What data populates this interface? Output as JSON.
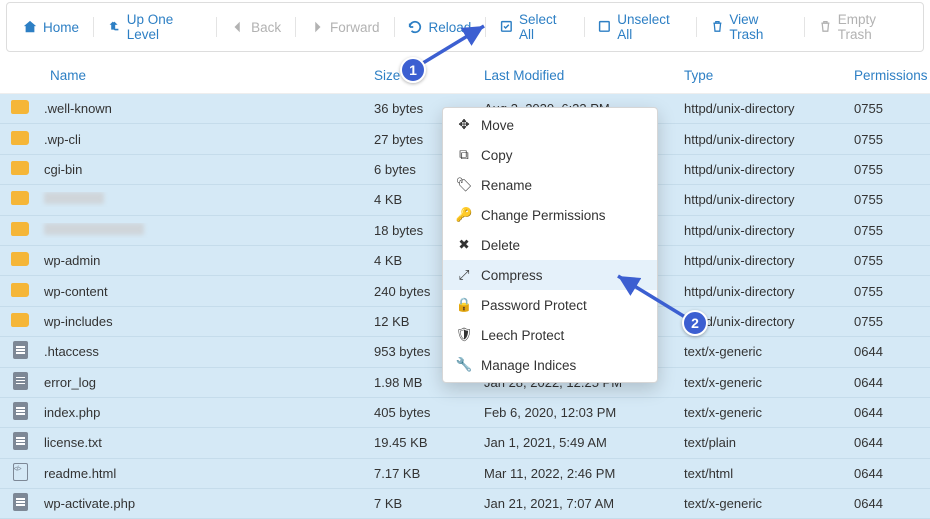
{
  "toolbar": {
    "home": "Home",
    "up": "Up One Level",
    "back": "Back",
    "forward": "Forward",
    "reload": "Reload",
    "select_all": "Select All",
    "unselect_all": "Unselect All",
    "view_trash": "View Trash",
    "empty_trash": "Empty Trash"
  },
  "columns": {
    "name": "Name",
    "size": "Size",
    "modified": "Last Modified",
    "type": "Type",
    "permissions": "Permissions"
  },
  "rows": [
    {
      "icon": "folder",
      "name": ".well-known",
      "size": "36 bytes",
      "modified": "Aug 3, 2020, 6:23 PM",
      "type": "httpd/unix-directory",
      "perm": "0755"
    },
    {
      "icon": "folder",
      "name": ".wp-cli",
      "size": "27 bytes",
      "modified": "",
      "type": "httpd/unix-directory",
      "perm": "0755"
    },
    {
      "icon": "folder",
      "name": "cgi-bin",
      "size": "6 bytes",
      "modified": "",
      "type": "httpd/unix-directory",
      "perm": "0755"
    },
    {
      "icon": "folder",
      "name": "",
      "redact": true,
      "size": "4 KB",
      "modified": "",
      "type": "httpd/unix-directory",
      "perm": "0755"
    },
    {
      "icon": "folder",
      "name": "",
      "redact": true,
      "redact_wide": true,
      "size": "18 bytes",
      "modified": "",
      "type": "httpd/unix-directory",
      "perm": "0755"
    },
    {
      "icon": "folder",
      "name": "wp-admin",
      "size": "4 KB",
      "modified": "",
      "type": "httpd/unix-directory",
      "perm": "0755"
    },
    {
      "icon": "folder",
      "name": "wp-content",
      "size": "240 bytes",
      "modified": "",
      "type": "httpd/unix-directory",
      "perm": "0755"
    },
    {
      "icon": "folder",
      "name": "wp-includes",
      "size": "12 KB",
      "modified": "",
      "type": "httpd/unix-directory",
      "perm": "0755"
    },
    {
      "icon": "file",
      "name": ".htaccess",
      "size": "953 bytes",
      "modified": "",
      "type": "text/x-generic",
      "perm": "0644"
    },
    {
      "icon": "file",
      "name": "error_log",
      "size": "1.98 MB",
      "modified": "Jan 28, 2022, 12:25 PM",
      "type": "text/x-generic",
      "perm": "0644"
    },
    {
      "icon": "file",
      "name": "index.php",
      "size": "405 bytes",
      "modified": "Feb 6, 2020, 12:03 PM",
      "type": "text/x-generic",
      "perm": "0644"
    },
    {
      "icon": "file",
      "name": "license.txt",
      "size": "19.45 KB",
      "modified": "Jan 1, 2021, 5:49 AM",
      "type": "text/plain",
      "perm": "0644"
    },
    {
      "icon": "code",
      "name": "readme.html",
      "size": "7.17 KB",
      "modified": "Mar 11, 2022, 2:46 PM",
      "type": "text/html",
      "perm": "0644"
    },
    {
      "icon": "file",
      "name": "wp-activate.php",
      "size": "7 KB",
      "modified": "Jan 21, 2021, 7:07 AM",
      "type": "text/x-generic",
      "perm": "0644"
    }
  ],
  "context_menu": {
    "move": "Move",
    "copy": "Copy",
    "rename": "Rename",
    "change_permissions": "Change Permissions",
    "delete": "Delete",
    "compress": "Compress",
    "password_protect": "Password Protect",
    "leech_protect": "Leech Protect",
    "manage_indices": "Manage Indices"
  },
  "callouts": {
    "one": "1",
    "two": "2"
  }
}
